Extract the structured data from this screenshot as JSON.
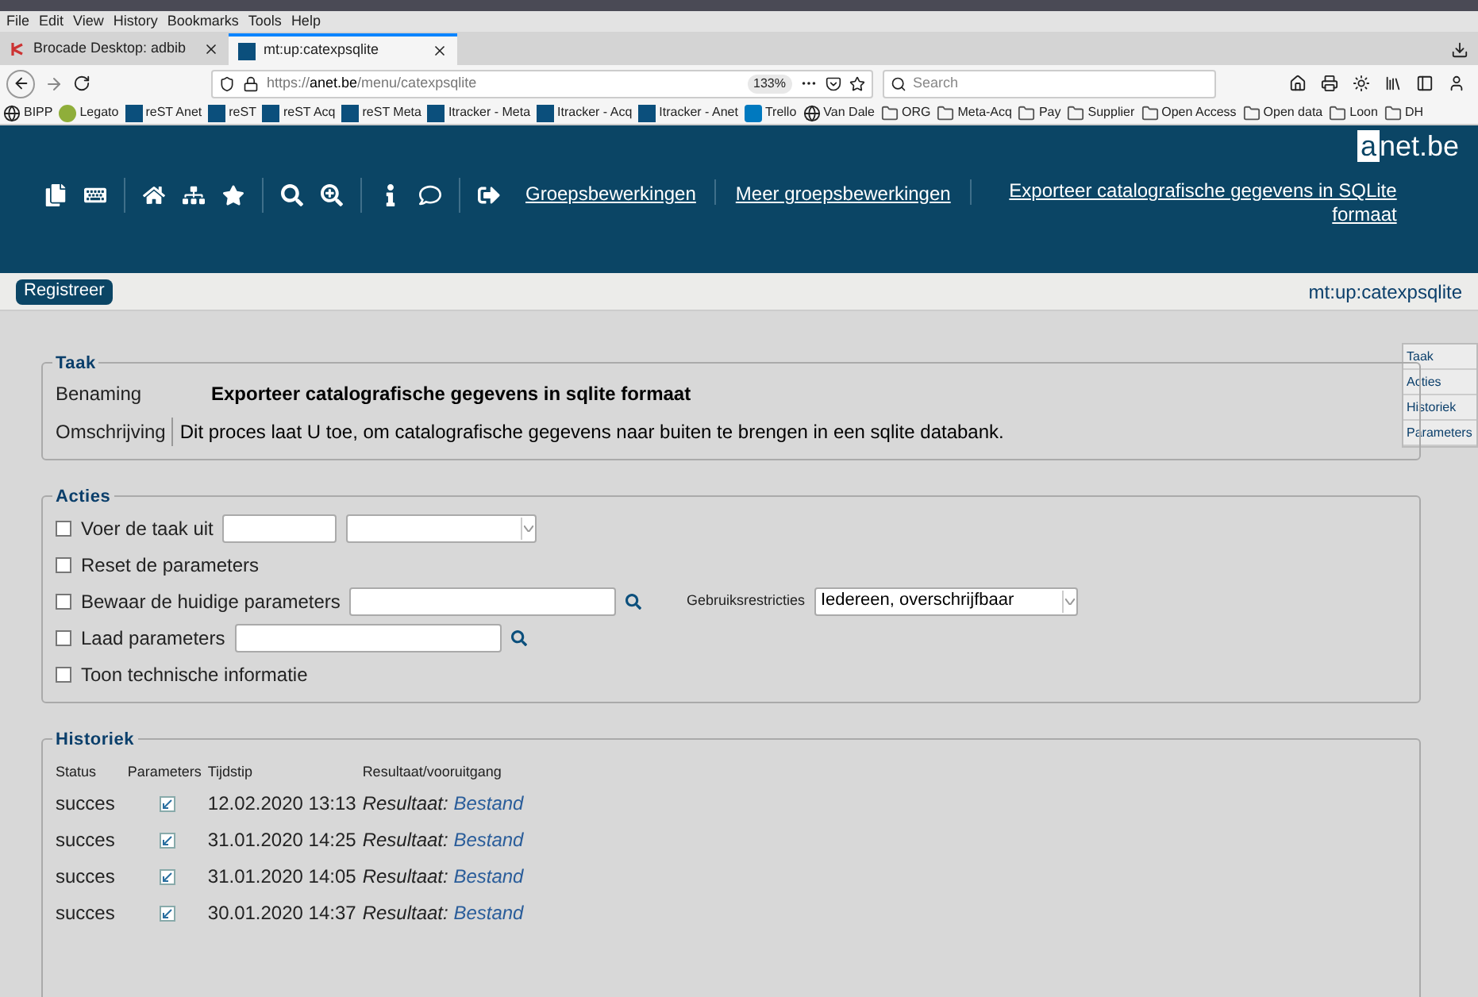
{
  "browser": {
    "menu": [
      "File",
      "Edit",
      "View",
      "History",
      "Bookmarks",
      "Tools",
      "Help"
    ],
    "tabs": [
      {
        "label": "Brocade Desktop: adbib",
        "selected": false,
        "kind": "brocade"
      },
      {
        "label": "mt:up:catexpsqlite",
        "selected": true,
        "kind": "anet"
      }
    ],
    "url_prefix": "https://",
    "url_domain": "anet.be",
    "url_path": "/menu/catexpsqlite",
    "zoom": "133%",
    "search_placeholder": "Search",
    "bookmarks": [
      {
        "label": "BIPP",
        "kind": "globe"
      },
      {
        "label": "Legato",
        "kind": "legato"
      },
      {
        "label": "reST Anet",
        "kind": "anet"
      },
      {
        "label": "reST",
        "kind": "anet"
      },
      {
        "label": "reST Acq",
        "kind": "anet"
      },
      {
        "label": "reST Meta",
        "kind": "anet"
      },
      {
        "label": "Itracker - Meta",
        "kind": "anet"
      },
      {
        "label": "Itracker - Acq",
        "kind": "anet"
      },
      {
        "label": "Itracker - Anet",
        "kind": "anet"
      },
      {
        "label": "Trello",
        "kind": "trello"
      },
      {
        "label": "Van Dale",
        "kind": "globe"
      },
      {
        "label": "ORG",
        "kind": "folder"
      },
      {
        "label": "Meta-Acq",
        "kind": "folder"
      },
      {
        "label": "Pay",
        "kind": "folder"
      },
      {
        "label": "Supplier",
        "kind": "folder"
      },
      {
        "label": "Open Access",
        "kind": "folder"
      },
      {
        "label": "Open data",
        "kind": "folder"
      },
      {
        "label": "Loon",
        "kind": "folder"
      },
      {
        "label": "DH",
        "kind": "folder"
      }
    ]
  },
  "header": {
    "logo_letter": "a",
    "logo_rest": "net.be",
    "links": [
      "Groepsbewerkingen",
      "Meer groepsbewerkingen",
      "Exporteer catalografische gegevens in SQLite formaat"
    ],
    "register_button": "Registreer",
    "page_code": "mt:up:catexpsqlite"
  },
  "side_tabs": [
    "Taak",
    "Acties",
    "Historiek",
    "Parameters"
  ],
  "taak": {
    "legend": "Taak",
    "fields": [
      {
        "label": "Benaming",
        "value": "Exporteer catalografische gegevens in sqlite formaat"
      },
      {
        "label": "Omschrijving",
        "value": "Dit proces laat U toe, om catalografische gegevens naar buiten te brengen in een sqlite databank."
      }
    ]
  },
  "acties": {
    "legend": "Acties",
    "rows": [
      {
        "label": "Voer de taak uit",
        "checked": false,
        "kind": "run"
      },
      {
        "label": "Reset de parameters",
        "checked": false,
        "kind": "plain"
      },
      {
        "label": "Bewaar de huidige parameters",
        "checked": false,
        "kind": "save",
        "restriction_label": "Gebruiksrestricties",
        "restriction_value": "Iedereen, overschrijfbaar"
      },
      {
        "label": "Laad parameters",
        "checked": false,
        "kind": "load"
      },
      {
        "label": "Toon technische informatie",
        "checked": false,
        "kind": "plain"
      }
    ]
  },
  "historiek": {
    "legend": "Historiek",
    "columns": [
      "Status",
      "Parameters",
      "Tijdstip",
      "Resultaat/vooruitgang"
    ],
    "rows": [
      {
        "status": "succes",
        "time": "12.02.2020 13:13",
        "result_label": "Resultaat:",
        "result_link": "Bestand"
      },
      {
        "status": "succes",
        "time": "31.01.2020 14:25",
        "result_label": "Resultaat:",
        "result_link": "Bestand"
      },
      {
        "status": "succes",
        "time": "31.01.2020 14:05",
        "result_label": "Resultaat:",
        "result_link": "Bestand"
      },
      {
        "status": "succes",
        "time": "30.01.2020 14:37",
        "result_label": "Resultaat:",
        "result_link": "Bestand"
      }
    ]
  }
}
